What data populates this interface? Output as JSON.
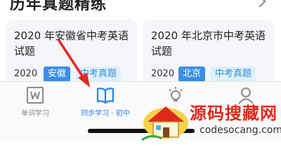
{
  "section": {
    "title": "历年真题精练"
  },
  "cards": [
    {
      "title": "2020 年安徽省中考英语试题",
      "year": "2020",
      "region_tag": "安徽",
      "type_tag": "中考真题"
    },
    {
      "title": "2020 年北京市中考英语试题",
      "year": "2020",
      "region_tag": "北京",
      "type_tag": "中考真题"
    }
  ],
  "tabbar": {
    "tabs": [
      {
        "label": "单词学习",
        "icon": "w-book-icon",
        "active": false
      },
      {
        "label": "同步学习 · 初中",
        "icon": "open-book-icon",
        "active": true
      },
      {
        "label": "",
        "icon": "lightbulb-icon",
        "active": false
      },
      {
        "label": "",
        "icon": "person-icon",
        "active": false
      }
    ]
  },
  "watermark": {
    "text": "源码搜藏网",
    "url": "codesocang.com"
  },
  "colors": {
    "accent": "#2a7ff3",
    "tag_blue": "#3a8ee6",
    "tag_light_bg": "#dff0fb",
    "annotation_red": "#e8261f",
    "watermark_red": "#e0291c"
  }
}
